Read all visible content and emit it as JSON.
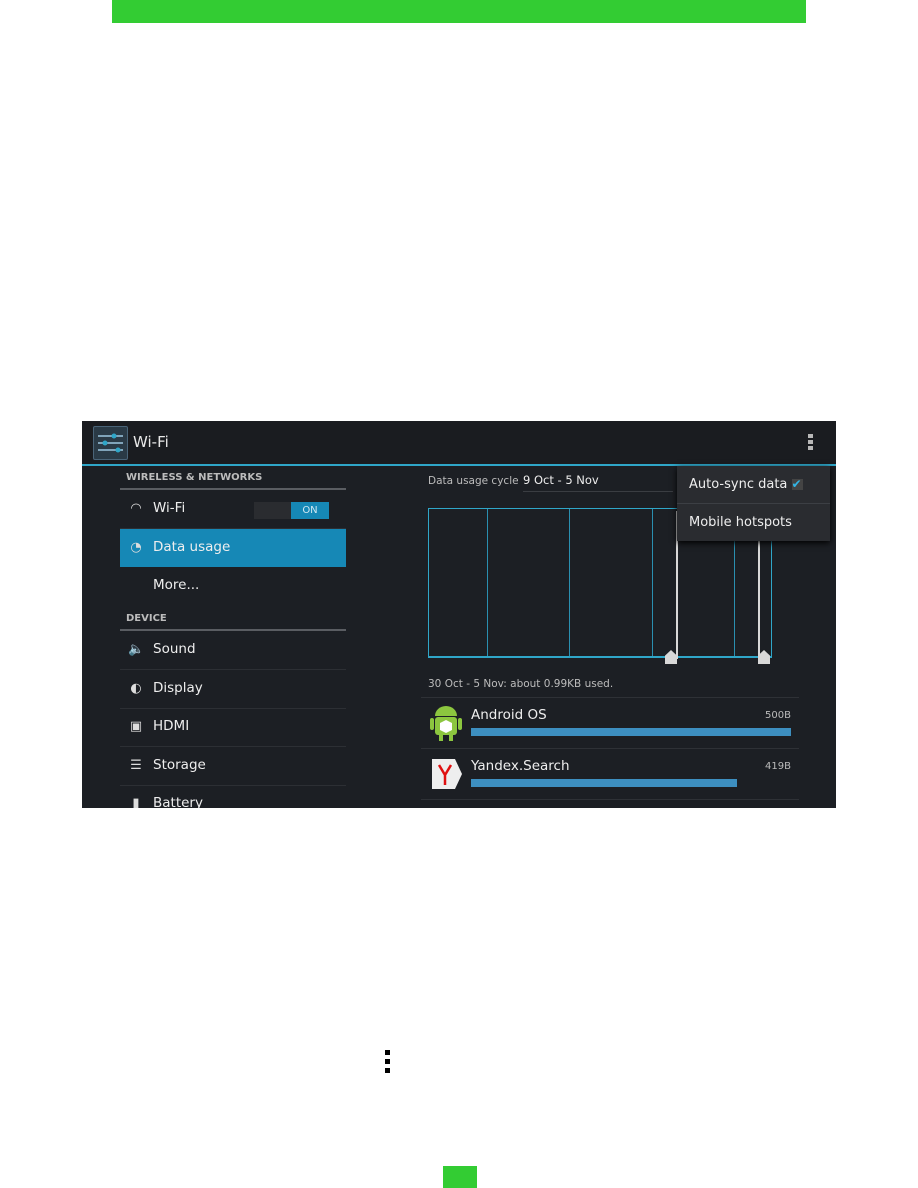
{
  "colors": {
    "header_bar": "#33cc33",
    "accent": "#1688b6",
    "background": "#1c1f24"
  },
  "action_bar": {
    "title": "Wi-Fi",
    "app_icon": "settings-sliders-icon",
    "overflow_icon": "overflow-menu-icon"
  },
  "sidebar": {
    "sections": [
      {
        "header": "WIRELESS & NETWORKS"
      },
      {
        "header": "DEVICE"
      }
    ],
    "items": [
      {
        "label": "Wi-Fi",
        "icon": "wifi-icon",
        "toggle": "ON"
      },
      {
        "label": "Data usage",
        "icon": "data-usage-icon",
        "selected": true
      },
      {
        "label": "More..."
      },
      {
        "label": "Sound",
        "icon": "speaker-icon"
      },
      {
        "label": "Display",
        "icon": "brightness-icon"
      },
      {
        "label": "HDMI",
        "icon": "hdmi-icon"
      },
      {
        "label": "Storage",
        "icon": "storage-icon"
      },
      {
        "label": "Battery",
        "icon": "battery-icon"
      }
    ]
  },
  "main": {
    "cycle_label": "Data usage cycle",
    "cycle_value": "9 Oct - 5 Nov",
    "summary": "30 Oct - 5 Nov: about 0.99KB used.",
    "apps": [
      {
        "name": "Android OS",
        "size": "500B",
        "fraction": 1.0,
        "icon": "android-icon"
      },
      {
        "name": "Yandex.Search",
        "size": "419B",
        "fraction": 0.83,
        "icon": "yandex-icon"
      }
    ]
  },
  "menu": {
    "items": [
      {
        "label": "Auto-sync data",
        "checked": true
      },
      {
        "label": "Mobile hotspots"
      }
    ]
  },
  "page": {
    "menu_glyph": "overflow-menu-icon"
  }
}
